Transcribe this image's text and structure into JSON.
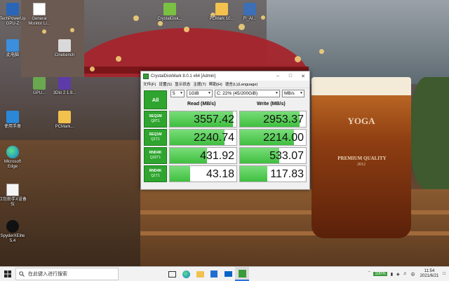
{
  "desktop": {
    "icons": [
      {
        "label": "TechPowerUp GPU-Z",
        "icon": "gpuz-icon"
      },
      {
        "label": "General Monitor Li...",
        "icon": "file-icon"
      },
      {
        "label": "Cinebench",
        "icon": "cinebench-icon"
      },
      {
        "label": "此电脑",
        "icon": "computer-icon"
      },
      {
        "label": "GPU...",
        "icon": "gpu-icon"
      },
      {
        "label": "3Dlo 2 1.9...",
        "icon": "3d-icon"
      },
      {
        "label": "PCMark...",
        "icon": "folder-icon"
      },
      {
        "label": "使用手册",
        "icon": "manual-icon"
      },
      {
        "label": "Microsoft Edge",
        "icon": "edge-icon"
      },
      {
        "label": "红包助手X设备仪",
        "icon": "app-icon"
      },
      {
        "label": "SpyderXElite 5.4",
        "icon": "spyder-icon"
      },
      {
        "label": "CrystalDisk...",
        "icon": "shortcut-icon"
      },
      {
        "label": "PCMark 10...",
        "icon": "folder-icon"
      },
      {
        "label": "Fl_AI...",
        "icon": "shortcut-icon"
      }
    ],
    "mug_text": {
      "brand": "YOGA",
      "banner": "PREMIUM QUALITY",
      "year": "2012"
    }
  },
  "window": {
    "title": "CrystalDiskMark 8.0.1 x64 [Admin]",
    "menu": [
      "文件(F)",
      "设置(S)",
      "显示状态",
      "主题(T)",
      "帮助(H)",
      "语言(L)(Language)"
    ],
    "all_label": "All",
    "count": "5",
    "size": "1GiB",
    "drive": "C: 22% (45/200GiB)",
    "unit": "MB/s",
    "read_header": "Read (MB/s)",
    "write_header": "Write (MB/s)",
    "rows": [
      {
        "name": "SEQ1M",
        "sub": "Q8T1",
        "read": "3557.42",
        "write": "2953.37",
        "read_frac": 0.95,
        "write_frac": 0.9
      },
      {
        "name": "SEQ1M",
        "sub": "Q1T1",
        "read": "2240.74",
        "write": "2214.00",
        "read_frac": 0.82,
        "write_frac": 0.82
      },
      {
        "name": "RND4K",
        "sub": "Q32T1",
        "read": "431.92",
        "write": "533.07",
        "read_frac": 0.56,
        "write_frac": 0.6
      },
      {
        "name": "RND4K",
        "sub": "Q1T1",
        "read": "43.18",
        "write": "117.83",
        "read_frac": 0.3,
        "write_frac": 0.42
      }
    ]
  },
  "taskbar": {
    "search_placeholder": "在此键入进行搜索",
    "battery": "100%",
    "time": "11:54",
    "date": "2021/6/21"
  },
  "colors": {
    "accent_green": "#2fa52f",
    "bar_green": "#4fcb4f"
  }
}
